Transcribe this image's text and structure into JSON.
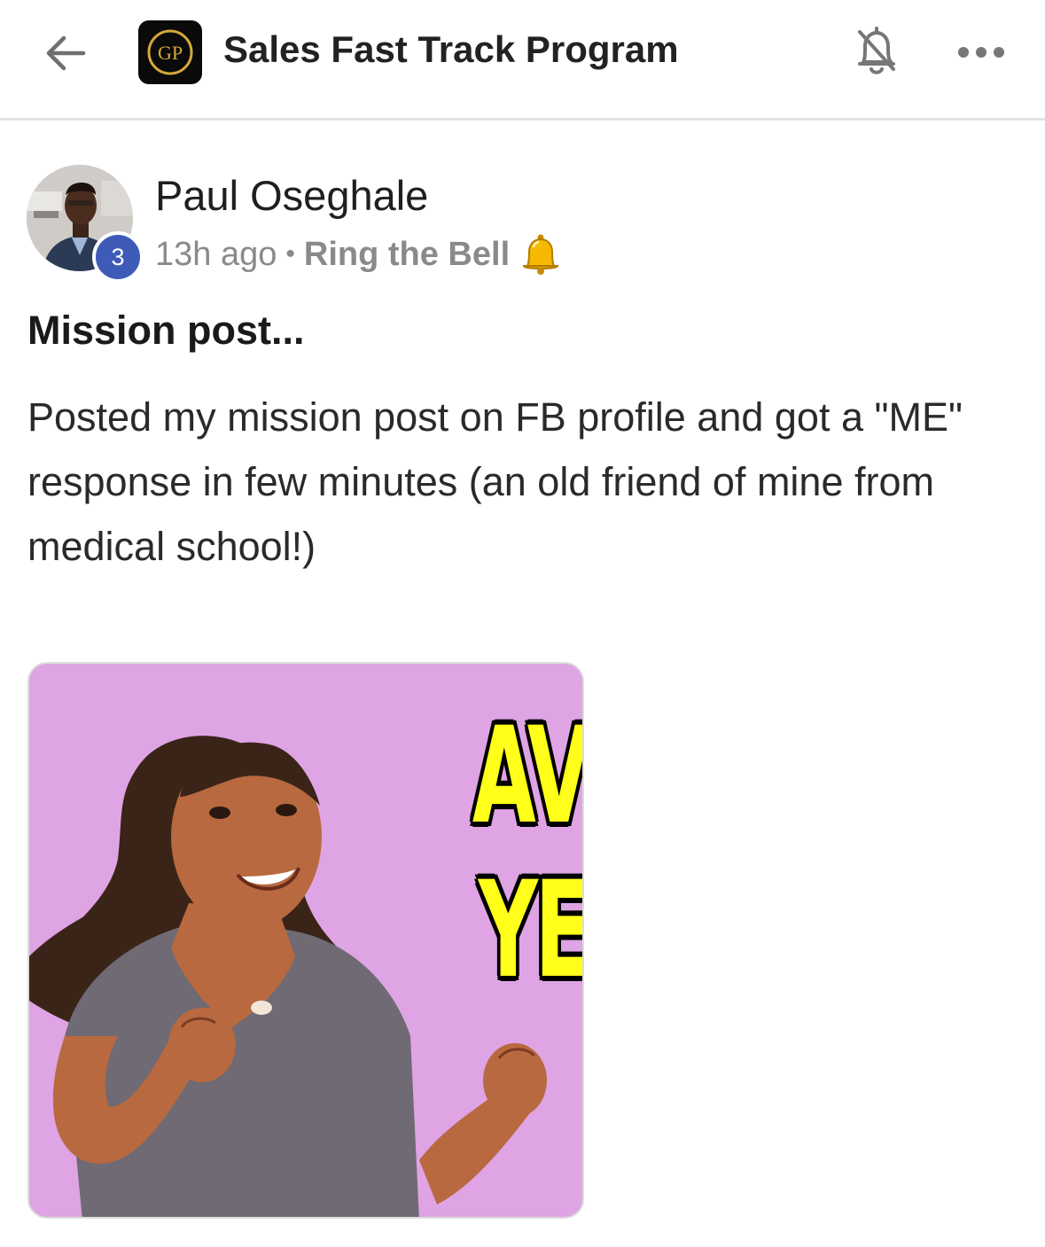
{
  "header": {
    "title": "Sales Fast Track Program",
    "logo_text": "GP",
    "icons": {
      "back": "arrow-left-icon",
      "notifications": "bell-off-icon",
      "more": "more-horizontal-icon"
    }
  },
  "post": {
    "author": {
      "name": "Paul Oseghale",
      "level": "3"
    },
    "time": "13h ago",
    "separator": "•",
    "category": "Ring the Bell",
    "category_icon": "bell-emoji",
    "title": "Mission post...",
    "body": "Posted my mission post on FB profile and got a \"ME\" response in few minutes (an old friend of mine from medical school!)",
    "media": {
      "type": "gif",
      "text_lines": [
        "AV",
        "YE"
      ]
    }
  },
  "colors": {
    "badge": "#3f5bb8",
    "gif_background": "#dfa4e4",
    "gif_text": "#ffff1a",
    "logo_gold": "#d4a93a"
  }
}
